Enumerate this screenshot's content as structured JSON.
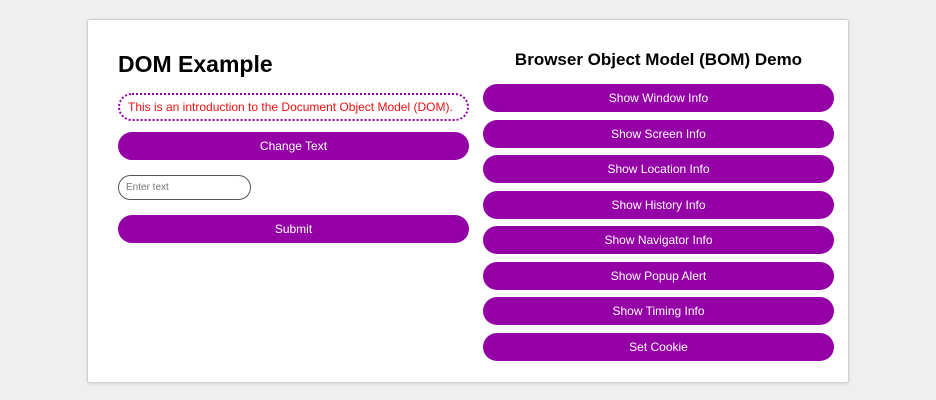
{
  "colors": {
    "accent": "#9400a6",
    "intro_text": "#ee1111",
    "page_background": "#efefef",
    "card_background": "#ffffff"
  },
  "dom": {
    "title": "DOM Example",
    "intro_text": "This is an introduction to the Document Object Model (DOM).",
    "change_text_label": "Change Text",
    "input": {
      "value": "",
      "placeholder": "Enter text"
    },
    "submit_label": "Submit"
  },
  "bom": {
    "title": "Browser Object Model (BOM) Demo",
    "buttons": [
      {
        "label": "Show Window Info"
      },
      {
        "label": "Show Screen Info"
      },
      {
        "label": "Show Location Info"
      },
      {
        "label": "Show History Info"
      },
      {
        "label": "Show Navigator Info"
      },
      {
        "label": "Show Popup Alert"
      },
      {
        "label": "Show Timing Info"
      },
      {
        "label": "Set Cookie"
      }
    ]
  }
}
